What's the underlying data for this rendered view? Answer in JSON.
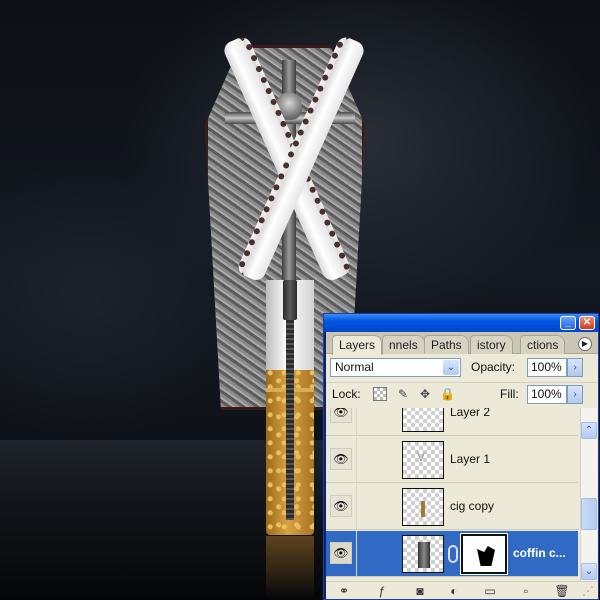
{
  "canvas": {
    "artwork": "zipper-cigarette-coffin",
    "background_color": "#0b0d12"
  },
  "layers_panel": {
    "title_buttons": {
      "minimize_icon": "minimize-icon",
      "close_icon": "close-icon"
    },
    "tabs": [
      {
        "label": "Layers",
        "active": true
      },
      {
        "label": "nnels",
        "active": false
      },
      {
        "label": "Paths",
        "active": false
      },
      {
        "label": "istory",
        "active": false
      },
      {
        "label": "ctions",
        "active": false
      }
    ],
    "blend_mode": "Normal",
    "opacity_label": "Opacity:",
    "opacity_value": "100%",
    "lock_label": "Lock:",
    "fill_label": "Fill:",
    "fill_value": "100%",
    "layers": [
      {
        "name": "Layer 2",
        "visible": true,
        "selected": false
      },
      {
        "name": "Layer 1",
        "visible": true,
        "selected": false
      },
      {
        "name": "cig copy",
        "visible": true,
        "selected": false
      },
      {
        "name": "coffin c...",
        "visible": true,
        "selected": true,
        "has_mask": true
      }
    ],
    "accent_color": "#316ac5",
    "footer_icons": [
      "link-layers-icon",
      "layer-style-icon",
      "add-mask-icon",
      "adjustment-layer-icon",
      "new-group-icon",
      "new-layer-icon",
      "trash-icon"
    ]
  }
}
